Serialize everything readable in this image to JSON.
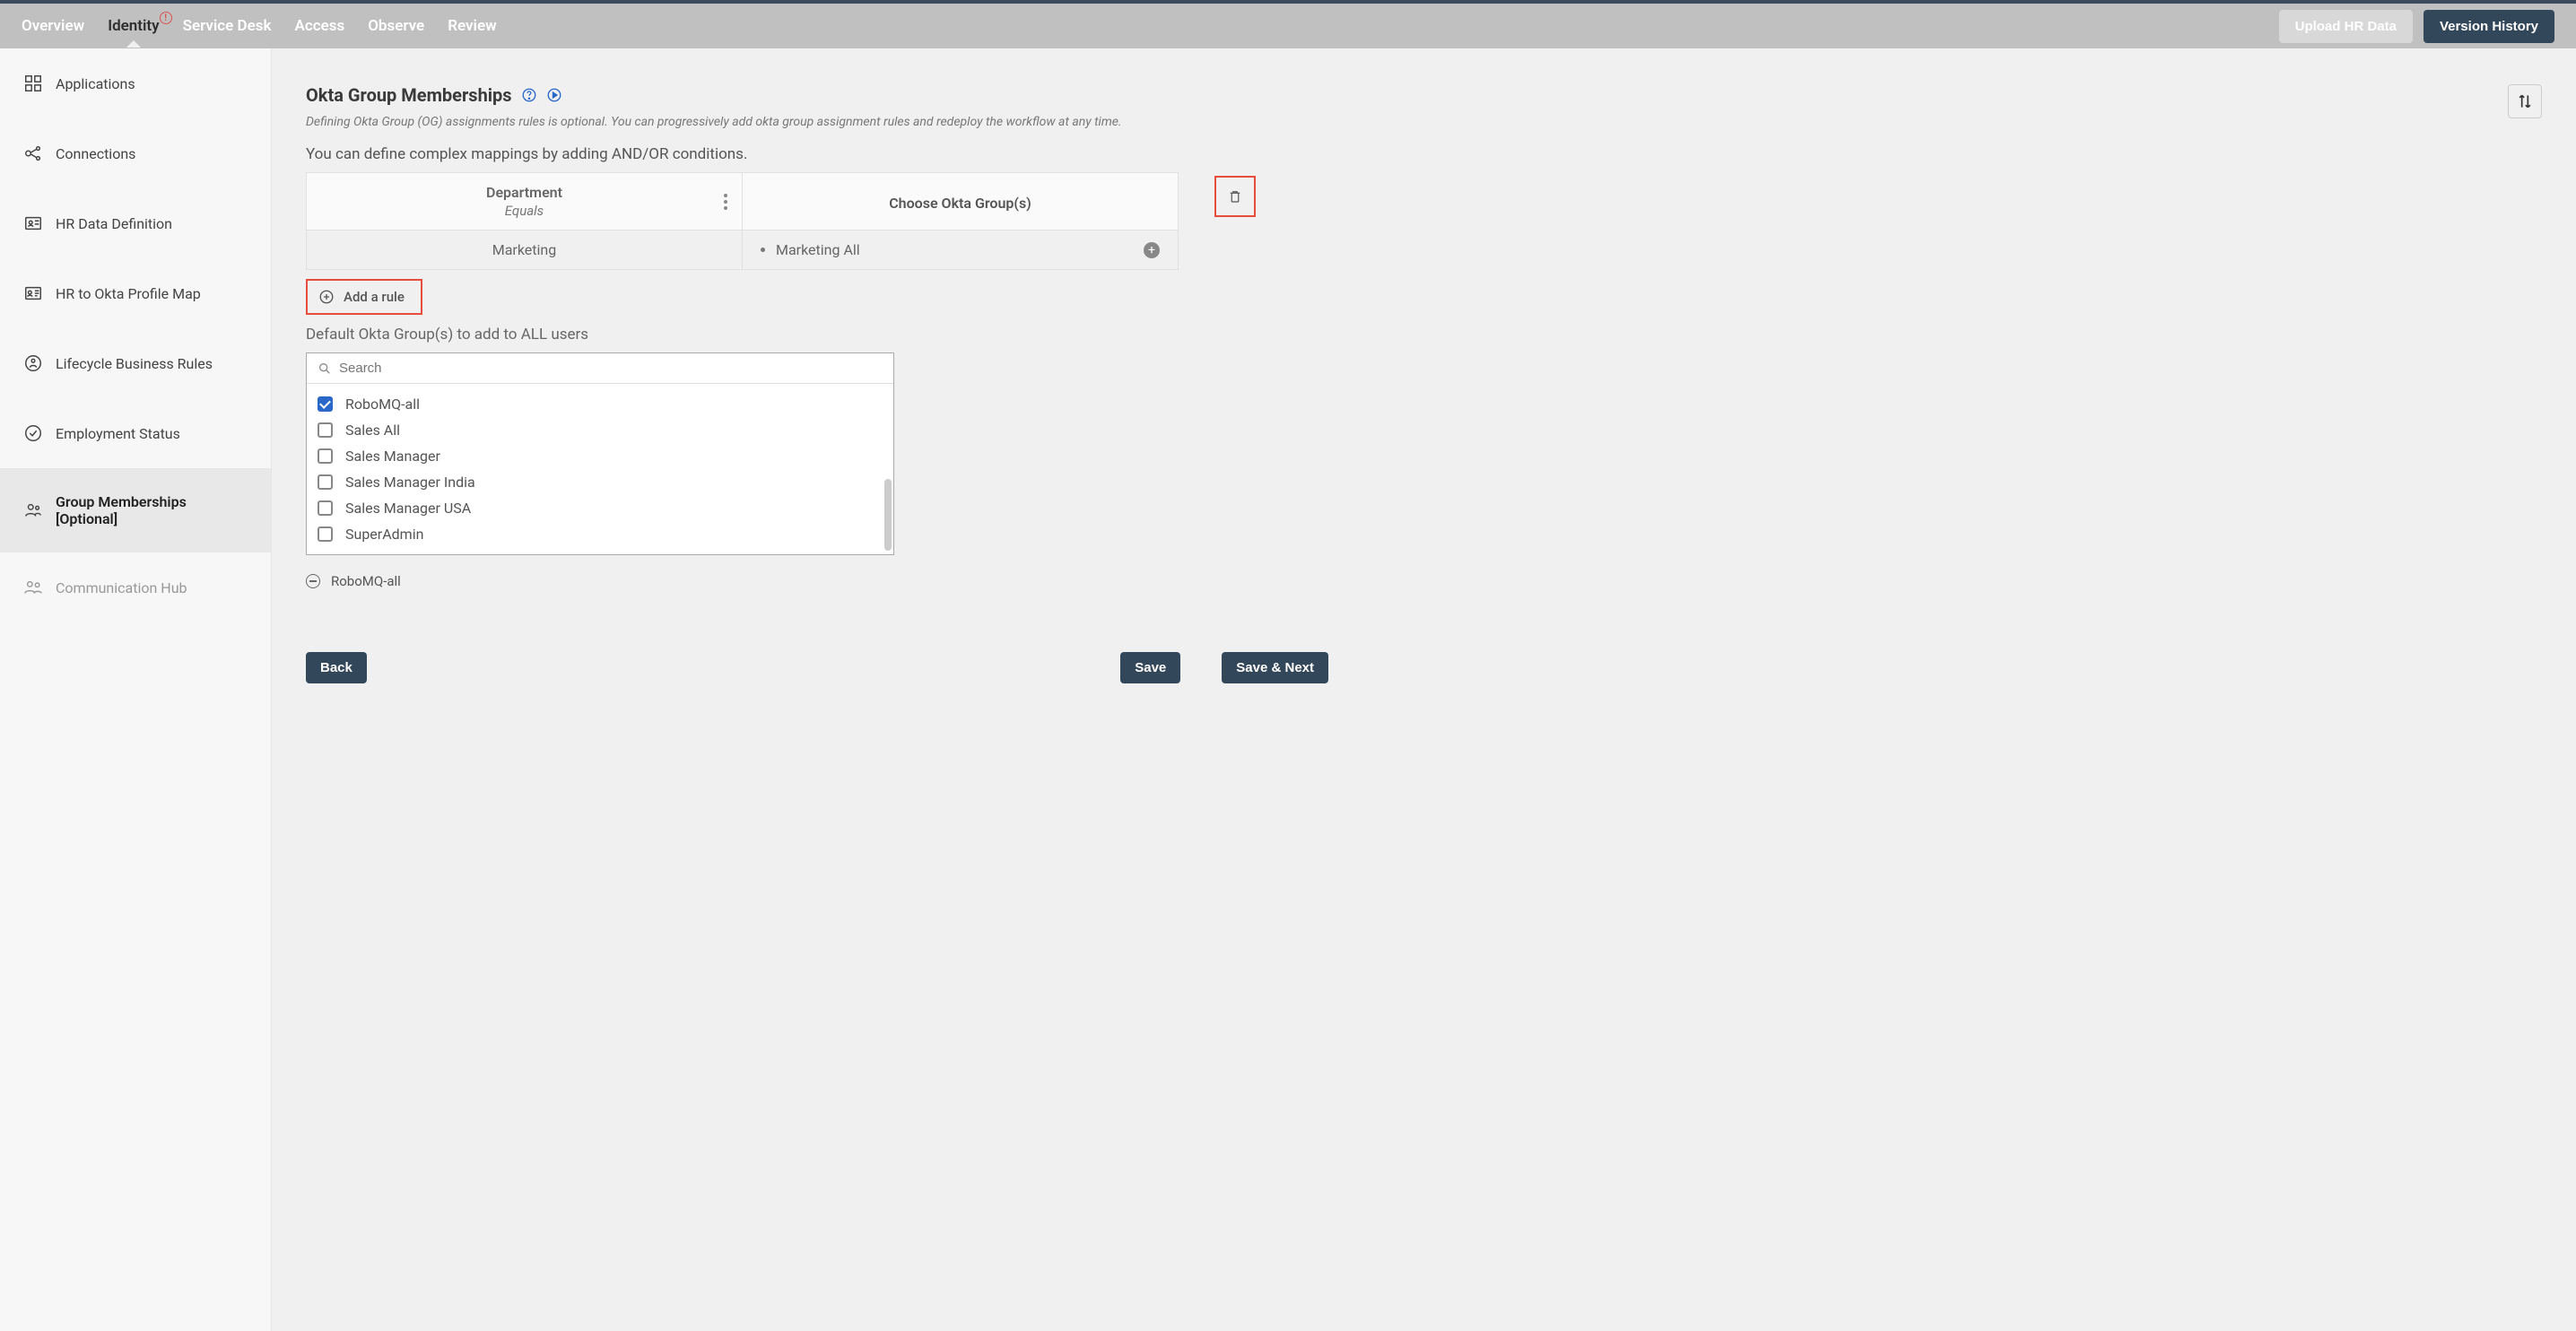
{
  "topnav": {
    "items": [
      "Overview",
      "Identity",
      "Service Desk",
      "Access",
      "Observe",
      "Review"
    ],
    "active_index": 1,
    "alert_on_index": 1
  },
  "topbar_buttons": {
    "upload": "Upload HR Data",
    "history": "Version History"
  },
  "sidebar": {
    "items": [
      {
        "label": "Applications"
      },
      {
        "label": "Connections"
      },
      {
        "label": "HR Data Definition"
      },
      {
        "label": "HR to Okta Profile Map"
      },
      {
        "label": "Lifecycle Business Rules"
      },
      {
        "label": "Employment Status"
      },
      {
        "label": "Group Memberships [Optional]"
      },
      {
        "label": "Communication Hub"
      }
    ],
    "active_index": 6,
    "disabled_index": 7
  },
  "main": {
    "title": "Okta Group Memberships",
    "subtitle_italic": "Defining Okta Group (OG) assignments rules is optional. You can progressively add okta group assignment rules and redeploy the workflow at any time.",
    "subheading": "You can define complex mappings by adding AND/OR conditions.",
    "rule": {
      "attr_label": "Department",
      "attr_op": "Equals",
      "choose_label": "Choose Okta Group(s)",
      "attr_value": "Marketing",
      "group_value": "Marketing All"
    },
    "add_rule_label": "Add a rule",
    "default_groups_label": "Default Okta Group(s) to add to ALL users",
    "search_placeholder": "Search",
    "options": [
      {
        "label": "RoboMQ-all",
        "checked": true
      },
      {
        "label": "Sales All",
        "checked": false
      },
      {
        "label": "Sales Manager",
        "checked": false
      },
      {
        "label": "Sales Manager India",
        "checked": false
      },
      {
        "label": "Sales Manager USA",
        "checked": false
      },
      {
        "label": "SuperAdmin",
        "checked": false
      }
    ],
    "selected_chip": "RoboMQ-all"
  },
  "footer": {
    "back": "Back",
    "save": "Save",
    "save_next": "Save & Next"
  }
}
